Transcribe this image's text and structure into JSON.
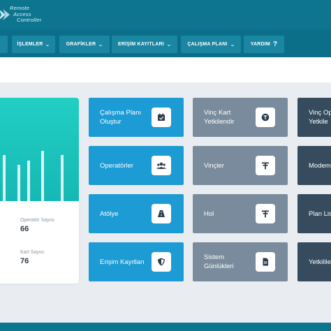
{
  "brand": {
    "line1": "Remote",
    "line2": "Access",
    "line3": "Controller"
  },
  "nav": [
    {
      "label": "",
      "chevron": false
    },
    {
      "label": "İŞLEMLER",
      "chevron": true
    },
    {
      "label": "GRAFİKLER",
      "chevron": true
    },
    {
      "label": "ERİŞİM KAYITLARI",
      "chevron": true
    },
    {
      "label": "ÇALIŞMA PLANI",
      "chevron": true
    },
    {
      "label": "YARDIM",
      "chevron": false
    }
  ],
  "stats": [
    {
      "label": "Operatör Sayısı",
      "value": "66"
    },
    {
      "label": "Kart Sayısı",
      "value": "76"
    }
  ],
  "tiles": {
    "col1": [
      {
        "label": "Çalışma Planı\nOluştur",
        "icon": "calendar-check-icon"
      },
      {
        "label": "Operatörler",
        "icon": "users-icon"
      },
      {
        "label": "Atölye",
        "icon": "road-icon"
      },
      {
        "label": "Erişim Kayıtları",
        "icon": "shield-icon"
      }
    ],
    "col2": [
      {
        "label": "Vinç Kart\nYetkilendir",
        "icon": "coin-icon"
      },
      {
        "label": "Vinçler",
        "icon": "crane-icon"
      },
      {
        "label": "Hol",
        "icon": "crane-icon"
      },
      {
        "label": "Sistem\nGünlükleri",
        "icon": "file-icon"
      }
    ],
    "col3": [
      {
        "label": "Vinç Op\nYetkile"
      },
      {
        "label": "Modem"
      },
      {
        "label": "Plan Lis"
      },
      {
        "label": "Yetkilile"
      }
    ]
  },
  "colors": {
    "topbar": "#0e7590",
    "navbar": "#0b6f8a",
    "tile_blue": "#1d9bd4",
    "tile_gray": "#798b9c",
    "tile_dark": "#364c5e",
    "chart_teal": "#1ec8c0"
  }
}
